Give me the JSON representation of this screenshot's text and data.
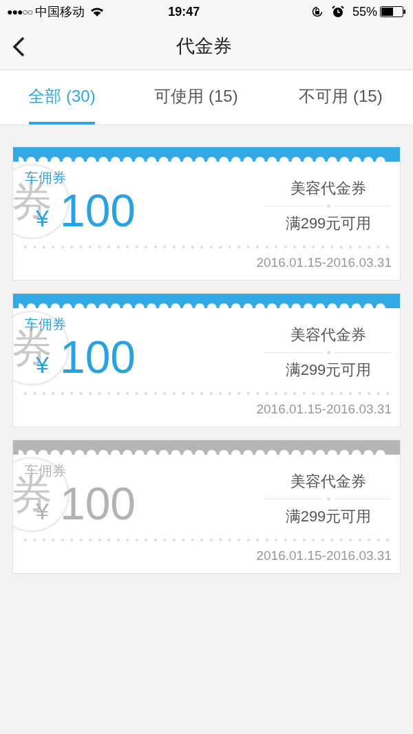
{
  "status_bar": {
    "signal": "●●●○○",
    "carrier": "中国移动",
    "time": "19:47",
    "battery": "55%"
  },
  "nav": {
    "title": "代金券"
  },
  "tabs": [
    {
      "label": "全部 (30)",
      "selected": true
    },
    {
      "label": "可使用 (15)",
      "selected": false
    },
    {
      "label": "不可用 (15)",
      "selected": false
    }
  ],
  "coupons": [
    {
      "stamp": "券",
      "type": "车佣券",
      "currency": "¥",
      "amount": "100",
      "name": "美容代金券",
      "condition": "满299元可用",
      "validity": "2016.01.15-2016.03.31",
      "usable": true
    },
    {
      "stamp": "券",
      "type": "车佣券",
      "currency": "¥",
      "amount": "100",
      "name": "美容代金券",
      "condition": "满299元可用",
      "validity": "2016.01.15-2016.03.31",
      "usable": true
    },
    {
      "stamp": "券",
      "type": "车佣券",
      "currency": "¥",
      "amount": "100",
      "name": "美容代金券",
      "condition": "满299元可用",
      "validity": "2016.01.15-2016.03.31",
      "usable": false
    }
  ]
}
